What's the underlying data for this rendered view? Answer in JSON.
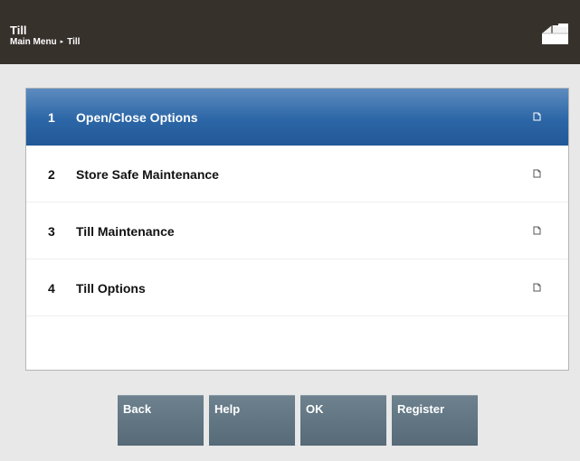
{
  "header": {
    "title": "Till",
    "breadcrumb": [
      "Main Menu",
      "Till"
    ],
    "breadcrumb_separator": "▸"
  },
  "menu": {
    "items": [
      {
        "number": "1",
        "label": "Open/Close Options",
        "selected": true
      },
      {
        "number": "2",
        "label": "Store Safe Maintenance",
        "selected": false
      },
      {
        "number": "3",
        "label": "Till Maintenance",
        "selected": false
      },
      {
        "number": "4",
        "label": "Till Options",
        "selected": false
      }
    ]
  },
  "buttons": {
    "back": "Back",
    "help": "Help",
    "ok": "OK",
    "register": "Register"
  },
  "icons": {
    "header_right": "cash-drawer-icon",
    "row_trailing": "document-icon"
  },
  "colors": {
    "header_bg": "#37312c",
    "selected_row": "#2c66a6",
    "button_bg": "#5f7482",
    "panel_bg": "#e8e8e8"
  }
}
